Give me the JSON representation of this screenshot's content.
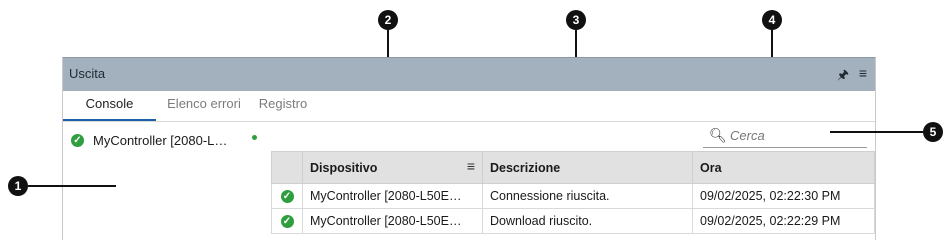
{
  "panel": {
    "title": "Uscita",
    "pin_icon": "pin-icon",
    "menu_icon": "hamburger-menu-icon",
    "pin_glyph": "🖈",
    "menu_glyph": "≡"
  },
  "tabs": [
    {
      "label": "Console",
      "active": true
    },
    {
      "label": "Elenco errori",
      "active": false
    },
    {
      "label": "Registro",
      "active": false
    }
  ],
  "left_list": {
    "item": "MyController [2080-L…",
    "status_icon": "check-circle-icon",
    "status_color": "#2e9e3e"
  },
  "search": {
    "placeholder": "Cerca",
    "icon": "search-icon",
    "glyph": "🔍"
  },
  "table": {
    "columns": [
      "",
      "Dispositivo",
      "Descrizione",
      "Ora"
    ],
    "column_menu_glyph": "≡",
    "rows": [
      {
        "status": "ok",
        "device": "MyController [2080-L50E…",
        "description": "Connessione riuscita.",
        "time": "09/02/2025, 02:22:30 PM"
      },
      {
        "status": "ok",
        "device": "MyController [2080-L50E…",
        "description": "Download riuscito.",
        "time": "09/02/2025, 02:22:29 PM"
      }
    ]
  },
  "callouts": [
    "1",
    "2",
    "3",
    "4",
    "5"
  ],
  "colors": {
    "accent": "#1f5fa8",
    "titlebar": "#a3b1be",
    "success": "#2e9e3e"
  }
}
